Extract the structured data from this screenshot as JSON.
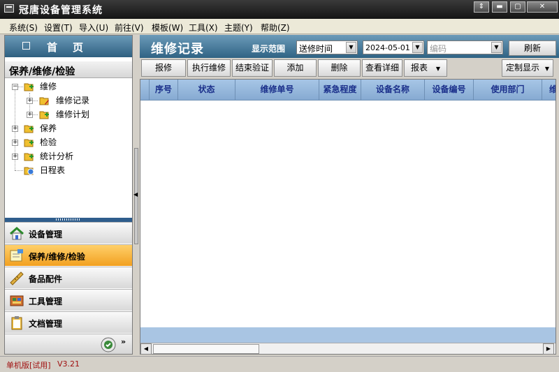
{
  "window": {
    "title": "冠唐设备管理系统"
  },
  "menu": [
    "系统(S)",
    "设置(T)",
    "导入(U)",
    "前往(V)",
    "模板(W)",
    "工具(X)",
    "主题(Y)",
    "帮助(Z)"
  ],
  "sidebar": {
    "home_label": "首页",
    "section_title": "保养/维修/检验",
    "tree": [
      {
        "label": "维修",
        "icon": "folder-add-icon"
      },
      {
        "label": "维修记录",
        "icon": "folder-edit-icon"
      },
      {
        "label": "维修计划",
        "icon": "folder-add-icon"
      },
      {
        "label": "保养",
        "icon": "folder-add-icon"
      },
      {
        "label": "检验",
        "icon": "folder-add-icon"
      },
      {
        "label": "统计分析",
        "icon": "folder-add-icon"
      },
      {
        "label": "日程表",
        "icon": "folder-clock-icon"
      }
    ],
    "nav": [
      {
        "label": "设备管理",
        "icon": "house-icon"
      },
      {
        "label": "保养/维修/检验",
        "icon": "notes-icon",
        "active": true
      },
      {
        "label": "备品配件",
        "icon": "ruler-icon"
      },
      {
        "label": "工具管理",
        "icon": "tools-icon"
      },
      {
        "label": "文档管理",
        "icon": "clipboard-icon"
      }
    ]
  },
  "header": {
    "page_title": "维修记录",
    "range_label": "显示范围",
    "range_select": "送修时间",
    "date_value": "2024-05-01",
    "filter_placeholder": "编码",
    "refresh_label": "刷新"
  },
  "toolbar": [
    "报修",
    "执行维修",
    "结束验证",
    "添加",
    "删除",
    "查看详细",
    "报表",
    "定制显示"
  ],
  "table": {
    "columns": [
      "序号",
      "状态",
      "维修单号",
      "紧急程度",
      "设备名称",
      "设备编号",
      "使用部门",
      "维"
    ]
  },
  "status": {
    "edition": "单机版[试用]",
    "version": "V3.21"
  },
  "colors": {
    "accent": "#2f6384",
    "active_nav": "#f2a020",
    "grid_header": "#94b6db",
    "status_text": "#a01010"
  }
}
